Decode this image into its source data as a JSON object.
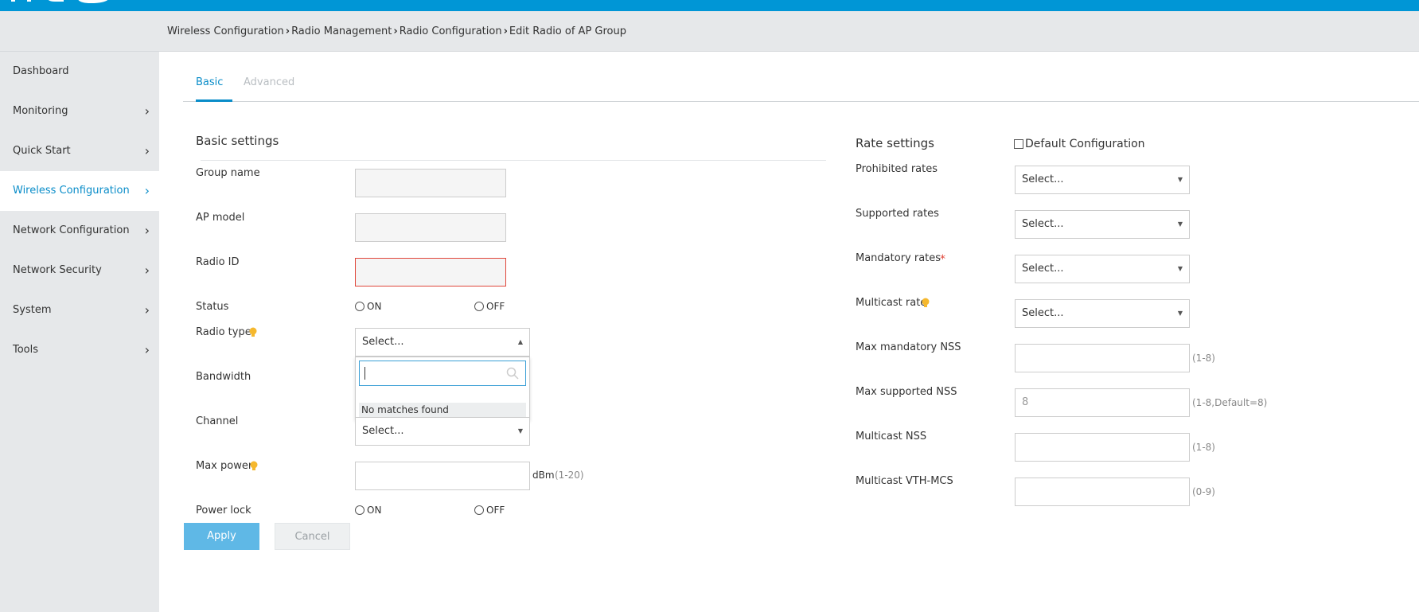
{
  "breadcrumb": [
    "Wireless Configuration",
    "Radio Management",
    "Radio Configuration",
    "Edit Radio of AP Group"
  ],
  "sidebar": {
    "items": [
      {
        "label": "Dashboard"
      },
      {
        "label": "Monitoring"
      },
      {
        "label": "Quick Start"
      },
      {
        "label": "Wireless Configuration"
      },
      {
        "label": "Network Configuration"
      },
      {
        "label": "Network Security"
      },
      {
        "label": "System"
      },
      {
        "label": "Tools"
      }
    ]
  },
  "tabs": {
    "basic": "Basic",
    "advanced": "Advanced"
  },
  "basic": {
    "title": "Basic settings",
    "group_name": "Group name",
    "ap_model": "AP model",
    "radio_id": "Radio ID",
    "status": "Status",
    "radio_type": "Radio type",
    "bandwidth": "Bandwidth",
    "channel": "Channel",
    "max_power": "Max power",
    "power_lock": "Power lock",
    "on": "ON",
    "off": "OFF",
    "select_placeholder": "Select...",
    "dbm": "dBm",
    "max_power_range": "(1-20)",
    "no_matches": "No matches found"
  },
  "rate": {
    "title": "Rate settings",
    "default_config": "Default Configuration",
    "prohibited": "Prohibited rates",
    "supported": "Supported rates",
    "mandatory": "Mandatory rates",
    "required_mark": "*",
    "multicast_rate": "Multicast rate",
    "max_mandatory_nss": "Max mandatory NSS",
    "max_supported_nss": "Max supported NSS",
    "max_supported_nss_value": "8",
    "multicast_nss": "Multicast NSS",
    "multicast_vth_mcs": "Multicast VTH-MCS",
    "range_1_8": "(1-8)",
    "range_1_8_default": "(1-8,Default=8)",
    "range_0_9": "(0-9)",
    "select_placeholder": "Select..."
  },
  "buttons": {
    "apply": "Apply",
    "cancel": "Cancel"
  },
  "colors": {
    "brand_blue": "#0096d6",
    "accent": "#0a8dc9",
    "error": "#e0463a",
    "bulb": "#f5b82e"
  },
  "icons": [
    "chevron-right-icon",
    "lightbulb-icon",
    "search-icon",
    "caret-down-icon",
    "caret-up-icon"
  ]
}
